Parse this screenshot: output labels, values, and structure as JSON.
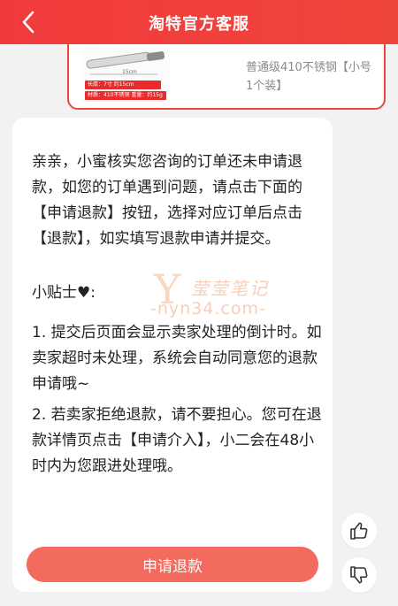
{
  "header": {
    "title": "淘特官方客服",
    "back_icon": "chevron-left-icon",
    "color": "#f23a3c"
  },
  "product": {
    "name": "普通级410不锈钢【小号1个装】",
    "thumb_tag_1": "长厚：7寸  约15cm",
    "thumb_tag_2": "材质：410不锈钢  重量：约15g",
    "thumb_dim": "15cm"
  },
  "message": {
    "intro": "亲亲，小蜜核实您咨询的订单还未申请退款，如您的订单遇到问题，请点击下面的【申请退款】按钮，选择对应订单后点击【退款】，如实填写退款申请并提交。",
    "tips_title": "小贴士",
    "tip_1": "1. 提交后页面会显示卖家处理的倒计时。如卖家超时未处理，系统会自动同意您的退款申请哦~",
    "tip_2": "2. 若卖家拒绝退款，请不要担心。您可在退款详情页点击【申请介入】，小二会在48小时内为您跟进处理哦。"
  },
  "actions": {
    "refund_button_label": "申请退款",
    "refund_button_color": "#f36a5f"
  },
  "feedback": {
    "like_icon": "thumbs-up-icon",
    "dislike_icon": "thumbs-down-icon"
  },
  "watermark": {
    "letter": "Y",
    "name": "莹莹笔记",
    "url": "-nyn34.com-"
  }
}
